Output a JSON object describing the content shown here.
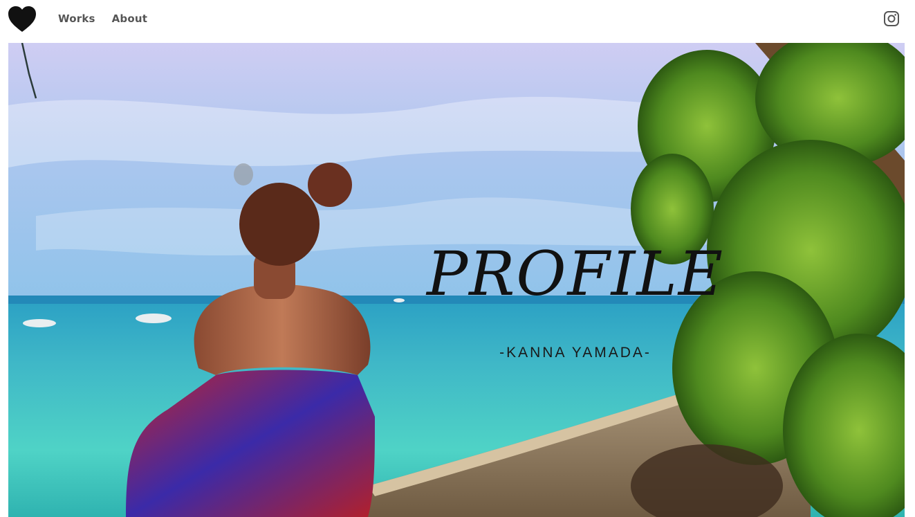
{
  "header": {
    "logo_icon": "heart-icon",
    "nav": [
      {
        "label": "Works"
      },
      {
        "label": "About"
      }
    ],
    "social_icon": "instagram-icon"
  },
  "hero": {
    "title": "PROFILE",
    "subtitle": "-KANNA YAMADA-"
  },
  "colors": {
    "nav_text": "#555555",
    "title_text": "#111111",
    "sky": "#a9c7f0",
    "sea": "#39c7c9",
    "foliage": "#4f8a1f"
  }
}
